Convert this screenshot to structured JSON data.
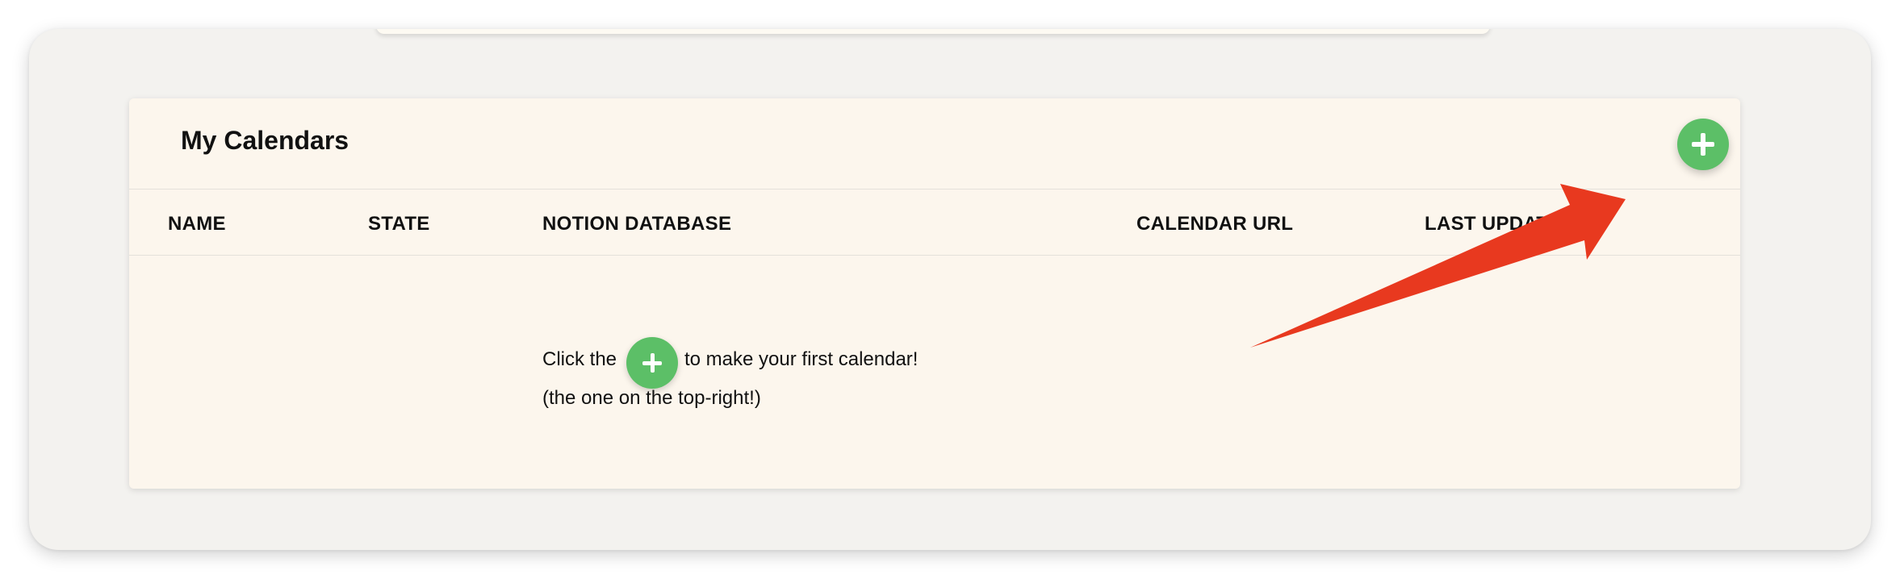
{
  "card": {
    "title": "My Calendars"
  },
  "header": {
    "add_button_icon": "plus-icon"
  },
  "table": {
    "columns": [
      "NAME",
      "STATE",
      "NOTION DATABASE",
      "CALENDAR URL",
      "LAST UPDATED"
    ]
  },
  "empty_state": {
    "line1_before": "Click the",
    "line1_after": "to make your first calendar!",
    "line2": "(the one on the top-right!)"
  },
  "colors": {
    "accent_green": "#5cbf67",
    "card_background": "#fcf6ed",
    "window_background": "#f3f2ef",
    "annotation_arrow": "#e8391f"
  }
}
